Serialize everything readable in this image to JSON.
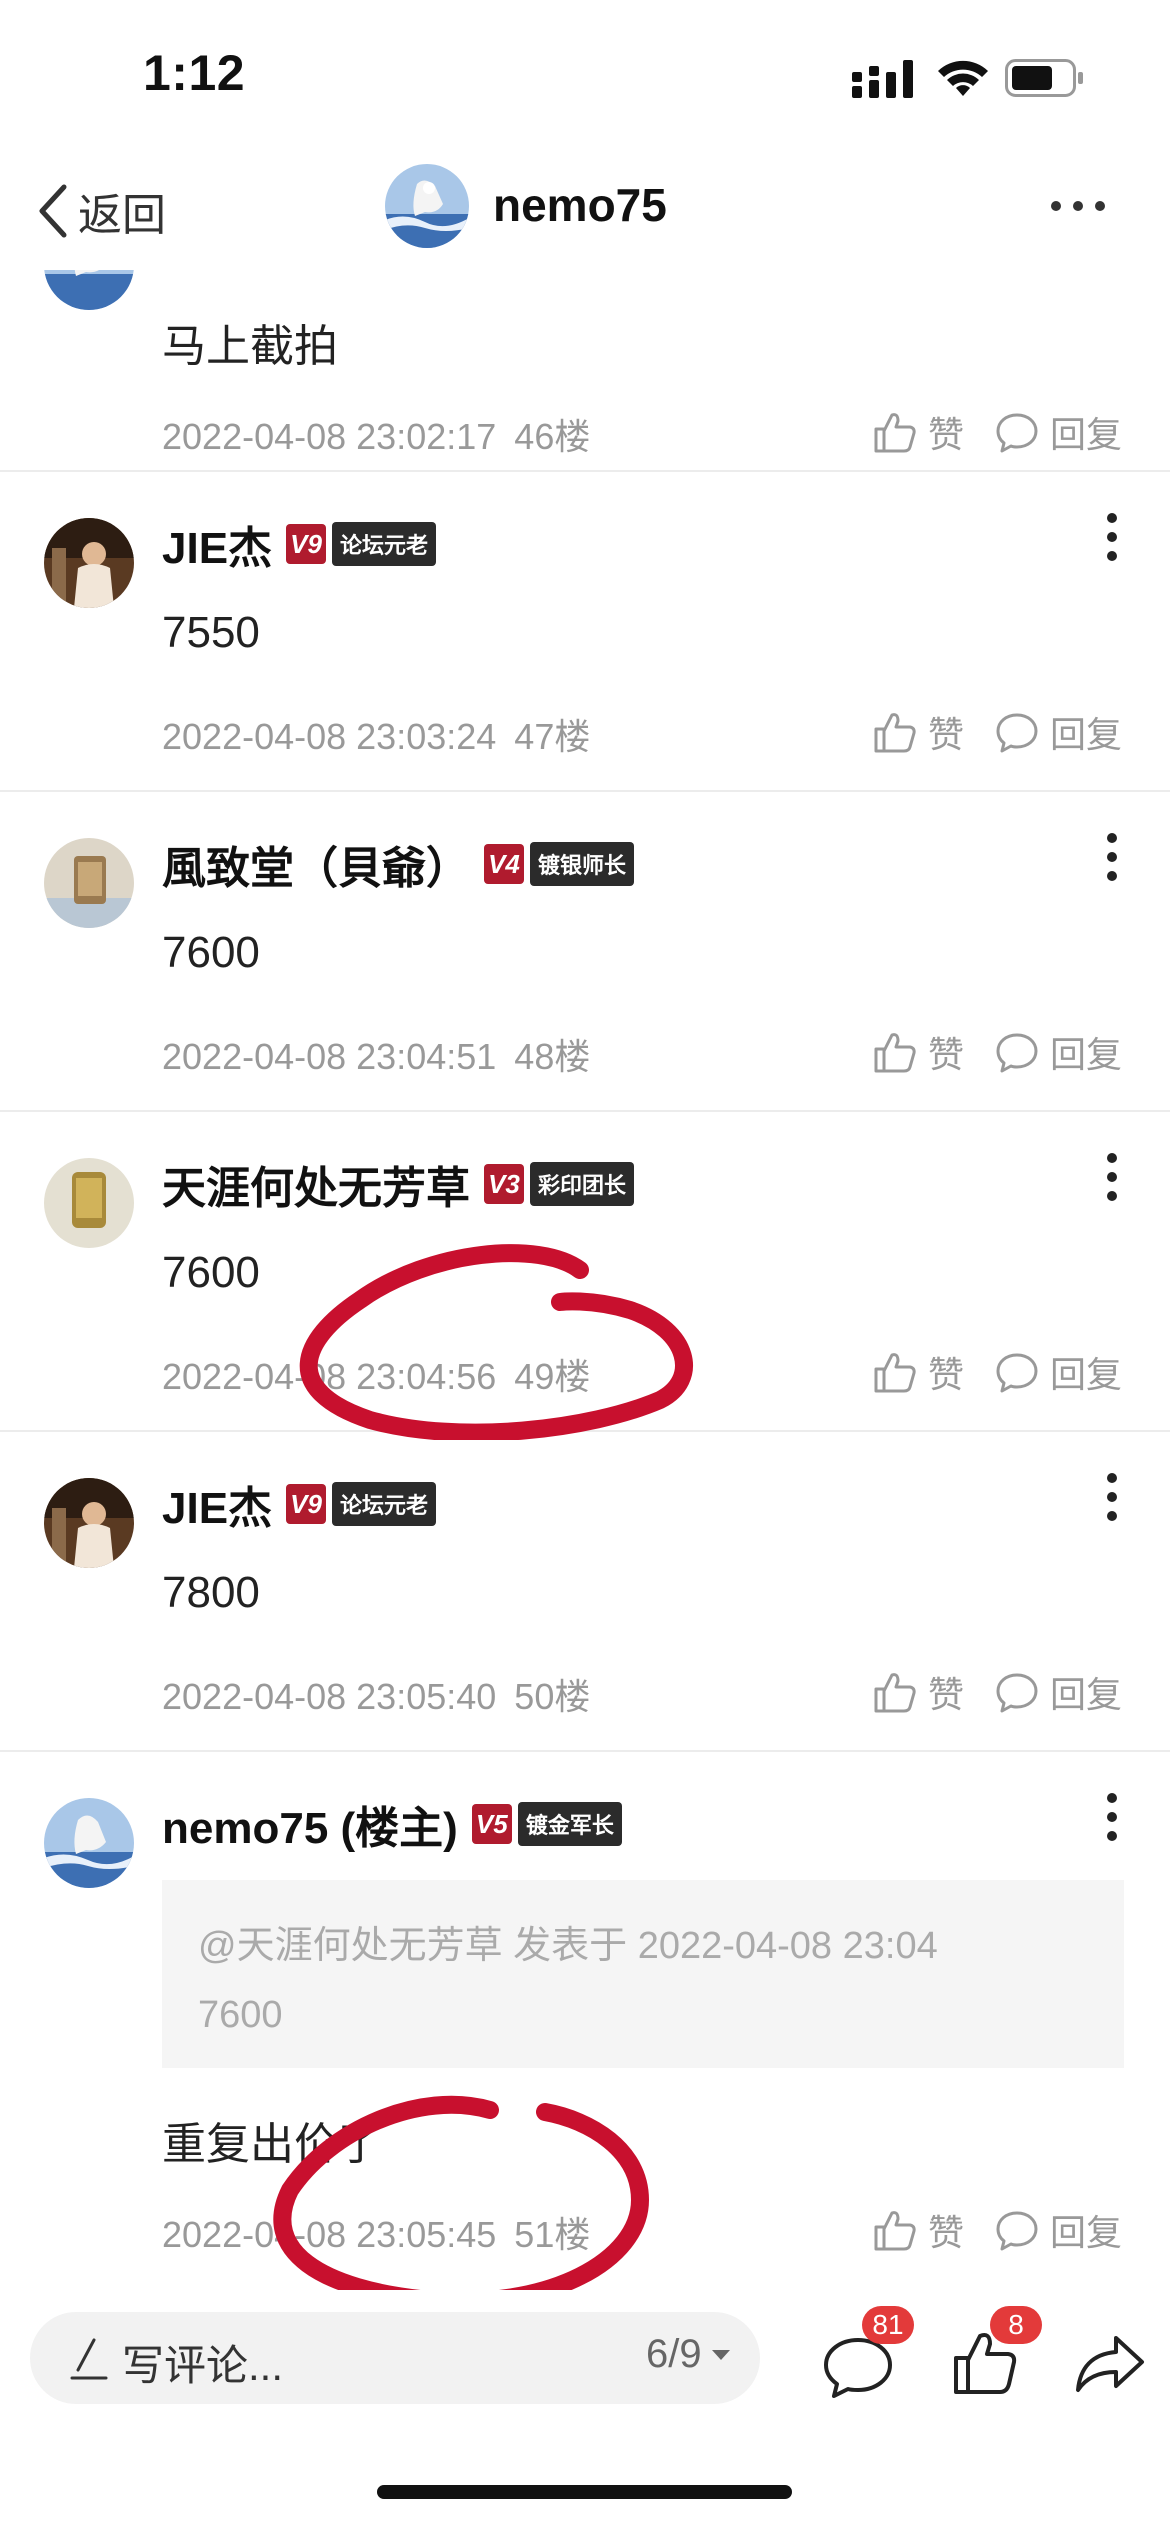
{
  "status": {
    "time": "1:12"
  },
  "nav": {
    "back_label": "返回",
    "title": "nemo75"
  },
  "posts": [
    {
      "content": "马上截拍",
      "timestamp": "2022-04-08 23:02:17",
      "floor": "46楼",
      "like_label": "赞",
      "reply_label": "回复"
    },
    {
      "username": "JIE杰",
      "level": "V9",
      "badge": "论坛元老",
      "content": "7550",
      "timestamp": "2022-04-08 23:03:24",
      "floor": "47楼",
      "like_label": "赞",
      "reply_label": "回复"
    },
    {
      "username": "風致堂（貝爺）",
      "level": "V4",
      "badge": "镀银师长",
      "content": "7600",
      "timestamp": "2022-04-08 23:04:51",
      "floor": "48楼",
      "like_label": "赞",
      "reply_label": "回复"
    },
    {
      "username": "天涯何处无芳草",
      "level": "V3",
      "badge": "彩印团长",
      "content": "7600",
      "timestamp": "2022-04-08 23:04:56",
      "floor": "49楼",
      "like_label": "赞",
      "reply_label": "回复"
    },
    {
      "username": "JIE杰",
      "level": "V9",
      "badge": "论坛元老",
      "content": "7800",
      "timestamp": "2022-04-08 23:05:40",
      "floor": "50楼",
      "like_label": "赞",
      "reply_label": "回复"
    },
    {
      "username": "nemo75 (楼主)",
      "level": "V5",
      "badge": "镀金军长",
      "quote_header": "@天涯何处无芳草 发表于 2022-04-08 23:04",
      "quote_text": "7600",
      "content": "重复出价了",
      "timestamp": "2022-04-08 23:05:45",
      "floor": "51楼",
      "like_label": "赞",
      "reply_label": "回复"
    }
  ],
  "bottom": {
    "comment_placeholder": "写评论...",
    "page_indicator": "6/9",
    "comment_count": "81",
    "like_count": "8"
  },
  "colors": {
    "accent_red": "#b01b2e",
    "badge_red": "#e33a3a",
    "annotation_red": "#c8102e"
  }
}
